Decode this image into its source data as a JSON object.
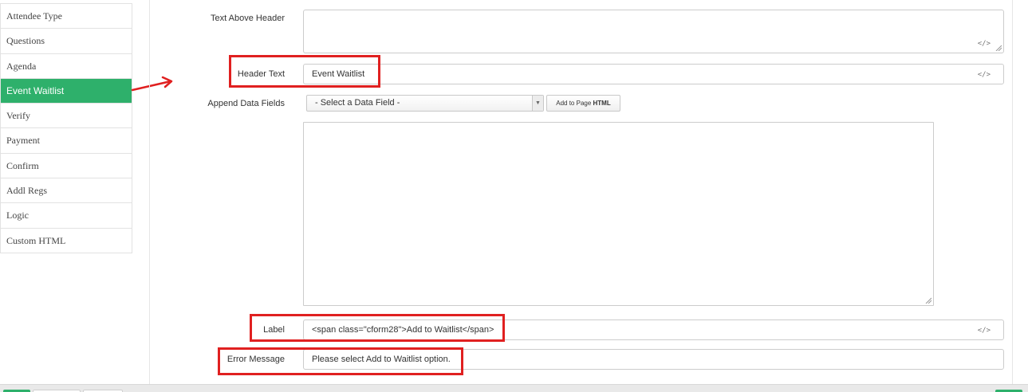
{
  "sidebar": {
    "items": [
      {
        "label": "Attendee Type"
      },
      {
        "label": "Questions"
      },
      {
        "label": "Agenda"
      },
      {
        "label": "Event Waitlist",
        "active": true
      },
      {
        "label": "Verify"
      },
      {
        "label": "Payment"
      },
      {
        "label": "Confirm"
      },
      {
        "label": "Addl Regs"
      },
      {
        "label": "Logic"
      },
      {
        "label": "Custom HTML"
      }
    ],
    "active_color": "#2eb06b"
  },
  "form": {
    "text_above_header": {
      "label": "Text Above Header",
      "value": ""
    },
    "header_text": {
      "label": "Header Text",
      "value": "Event Waitlist"
    },
    "append_data_fields": {
      "label": "Append Data Fields",
      "select_value": "- Select a Data Field -",
      "button_label_prefix": "Add to Page ",
      "button_label_bold": "HTML",
      "textarea_value": ""
    },
    "label_field": {
      "label": "Label",
      "value": "<span class=\"cform28\">Add to Waitlist</span>"
    },
    "error_message": {
      "label": "Error Message",
      "value": "Please select Add to Waitlist option."
    },
    "code_icon": "</>"
  },
  "annotation": {
    "color": "#e02020",
    "icon": "arrow-right-icon"
  }
}
